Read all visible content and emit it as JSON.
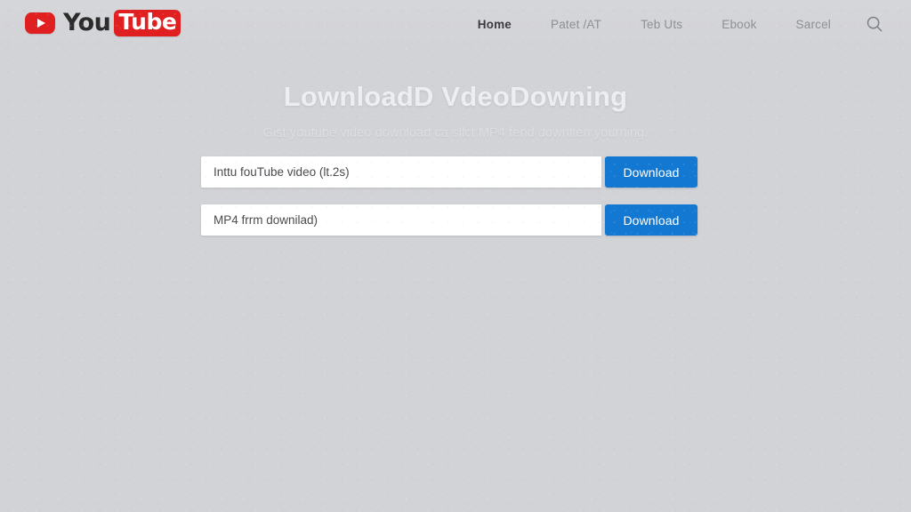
{
  "header": {
    "logo": {
      "play_icon": "youtube-play-icon",
      "word_you": "You",
      "word_tube": "Tube"
    },
    "nav_items": [
      {
        "label": "Home",
        "active": true
      },
      {
        "label": "Patet /AT",
        "active": false
      },
      {
        "label": "Teb Uts",
        "active": false
      },
      {
        "label": "Ebook",
        "active": false
      },
      {
        "label": "Sarcel",
        "active": false
      }
    ],
    "search_icon": "search-icon"
  },
  "hero": {
    "title": "LownloadD VdeoDowning",
    "subtitle": "Gist youtube video download ca sllct MP4 fend downlten yourning."
  },
  "forms": [
    {
      "input_placeholder": "Inttu fouTube video (lt.2s)",
      "input_value": "",
      "button_label": "Download"
    },
    {
      "input_placeholder": "MP4 frrm downilad)",
      "input_value": "",
      "button_label": "Download"
    }
  ],
  "colors": {
    "background": "#d2d3d7",
    "brand_red": "#e02020",
    "accent_blue": "#1378d2",
    "nav_active": "#3b3b3f",
    "nav_inactive": "#8e8f95",
    "hero_title": "#eceef1"
  }
}
